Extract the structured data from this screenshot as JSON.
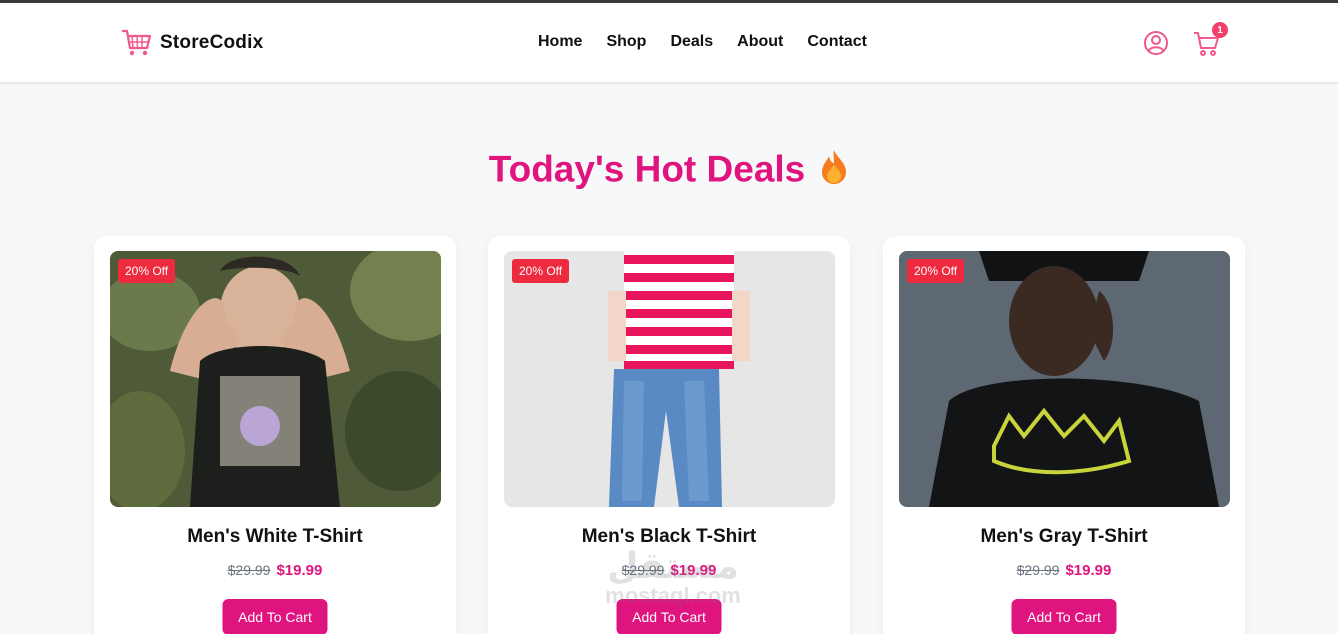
{
  "brand": {
    "name": "StoreCodix",
    "accent": "#e0147e"
  },
  "nav": {
    "items": [
      "Home",
      "Shop",
      "Deals",
      "About",
      "Contact"
    ]
  },
  "header_icons": {
    "account_icon": "user-circle-icon",
    "cart_icon": "cart-icon",
    "cart_count": "1"
  },
  "hero": {
    "title": "Today's Hot Deals"
  },
  "products": [
    {
      "badge": "20% Off",
      "title": "Men's White T-Shirt",
      "old_price": "$29.99",
      "price": "$19.99",
      "button": "Add To Cart"
    },
    {
      "badge": "20% Off",
      "title": "Men's Black T-Shirt",
      "old_price": "$29.99",
      "price": "$19.99",
      "button": "Add To Cart"
    },
    {
      "badge": "20% Off",
      "title": "Men's Gray T-Shirt",
      "old_price": "$29.99",
      "price": "$19.99",
      "button": "Add To Cart"
    }
  ],
  "watermark": {
    "line1": "مستقل",
    "line2": "mostaql.com"
  }
}
